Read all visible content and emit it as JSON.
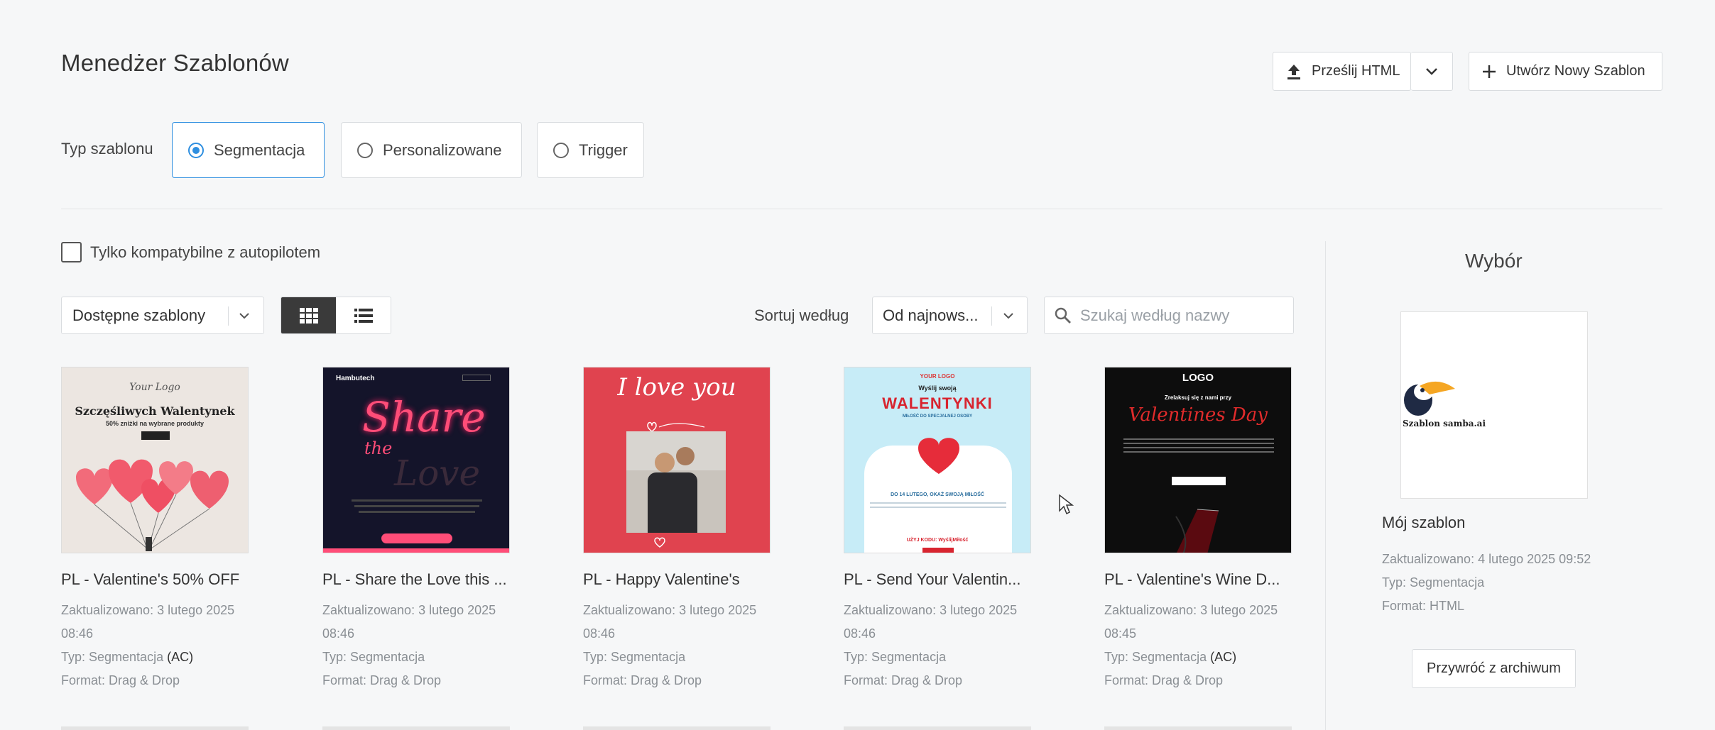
{
  "header": {
    "title": "Menedżer Szablonów",
    "upload_label": "Prześlij HTML",
    "create_label": "Utwórz Nowy Szablon"
  },
  "template_type": {
    "label": "Typ szablonu",
    "options": [
      "Segmentacja",
      "Personalizowane",
      "Trigger"
    ],
    "selected": "Segmentacja"
  },
  "filters": {
    "autopilot_label": "Tylko kompatybilne z autopilotem",
    "available_select": "Dostępne szablony",
    "sort_label": "Sortuj według",
    "sort_select": "Od najnows...",
    "search_placeholder": "Szukaj według nazwy"
  },
  "templates": [
    {
      "name": "PL - Valentine's 50% OFF",
      "updated_line1": "Zaktualizowano: 3 lutego 2025",
      "updated_line2": "08:46",
      "type_prefix": "Typ: Segmentacja",
      "type_suffix": "(AC)",
      "format": "Format: Drag & Drop",
      "thumb": {
        "t1": "Your Logo",
        "t2": "Szczęśliwych Walentynek",
        "t3": "50% zniżki na wybrane produkty"
      }
    },
    {
      "name": "PL - Share the Love this ...",
      "updated_line1": "Zaktualizowano: 3 lutego 2025",
      "updated_line2": "08:46",
      "type_prefix": "Typ: Segmentacja",
      "type_suffix": "",
      "format": "Format: Drag & Drop",
      "thumb": {
        "t1": "Hambutech",
        "t2": "Share",
        "t3": "the",
        "t4": "Love"
      }
    },
    {
      "name": "PL - Happy Valentine's",
      "updated_line1": "Zaktualizowano: 3 lutego 2025",
      "updated_line2": "08:46",
      "type_prefix": "Typ: Segmentacja",
      "type_suffix": "",
      "format": "Format: Drag & Drop",
      "thumb": {
        "t1": "I love you"
      }
    },
    {
      "name": "PL - Send Your Valentin...",
      "updated_line1": "Zaktualizowano: 3 lutego 2025",
      "updated_line2": "08:46",
      "type_prefix": "Typ: Segmentacja",
      "type_suffix": "",
      "format": "Format: Drag & Drop",
      "thumb": {
        "t1": "YOUR LOGO",
        "t2": "Wyślij swoją",
        "t3": "WALENTYNKI",
        "t4": "MIŁOŚĆ DO SPECJALNEJ OSOBY",
        "t5": "DO 14 LUTEGO, OKAŻ SWOJĄ MIŁOŚĆ",
        "t6": "UŻYJ KODU: WyślijMiłość"
      }
    },
    {
      "name": "PL - Valentine's Wine D...",
      "updated_line1": "Zaktualizowano: 3 lutego 2025",
      "updated_line2": "08:45",
      "type_prefix": "Typ: Segmentacja",
      "type_suffix": "(AC)",
      "format": "Format: Drag & Drop",
      "thumb": {
        "t1": "LOGO",
        "t2": "Zrelaksuj się z nami przy",
        "t3": "Valentines Day"
      }
    }
  ],
  "selection": {
    "title": "Wybór",
    "thumb_text": "Szablon samba.ai",
    "name": "Mój szablon",
    "updated": "Zaktualizowano: 4 lutego 2025 09:52",
    "type": "Typ: Segmentacja",
    "format": "Format: HTML",
    "restore_label": "Przywróć z archiwum"
  }
}
